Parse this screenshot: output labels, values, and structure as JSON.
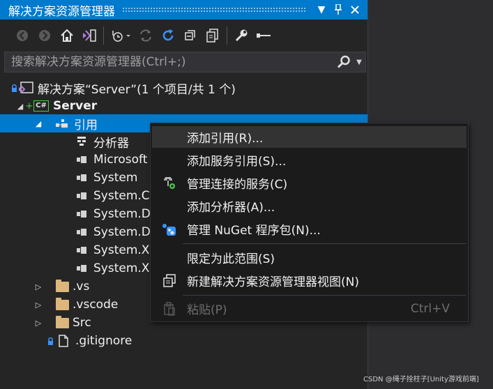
{
  "panel": {
    "title": "解决方案资源管理器",
    "title_buttons": [
      "dropdown-icon",
      "pin-icon",
      "close-icon"
    ]
  },
  "toolbar": {
    "icons": [
      "back-icon",
      "forward-icon",
      "home-icon",
      "vs-switch-views-icon",
      "pending-changes-filter-icon",
      "sync-icon",
      "refresh-icon",
      "collapse-all-icon",
      "show-all-files-icon",
      "properties-icon",
      "preview-icon"
    ]
  },
  "search": {
    "placeholder": "搜索解决方案资源管理器(Ctrl+;)"
  },
  "tree": {
    "solution": "解决方案“Server”(1 个项目/共 1 个)",
    "project": "Server",
    "references": "引用",
    "ref_items": [
      "分析器",
      "Microsoft",
      "System",
      "System.C",
      "System.D",
      "System.D",
      "System.X",
      "System.X"
    ],
    "folders": [
      ".vs",
      ".vscode",
      "Src"
    ],
    "file": ".gitignore",
    "csharp_badge": "C#"
  },
  "context_menu": {
    "items": [
      {
        "label": "添加引用(R)...",
        "icon": ""
      },
      {
        "label": "添加服务引用(S)...",
        "icon": ""
      },
      {
        "label": "管理连接的服务(C)",
        "icon": "connected-service-icon"
      },
      {
        "label": "添加分析器(A)...",
        "icon": ""
      },
      {
        "label": "管理 NuGet 程序包(N)...",
        "icon": "nuget-icon"
      },
      {
        "label": "限定为此范围(S)",
        "icon": ""
      },
      {
        "label": "新建解决方案资源管理器视图(N)",
        "icon": "new-view-icon"
      },
      {
        "label": "粘贴(P)",
        "icon": "paste-icon",
        "shortcut": "Ctrl+V",
        "disabled": true
      }
    ]
  },
  "watermark": "CSDN @绳子拴柱子[Unity游戏前端]",
  "colors": {
    "accent": "#007acc",
    "panel_bg": "#252526",
    "menu_bg": "#1b1b1c"
  }
}
